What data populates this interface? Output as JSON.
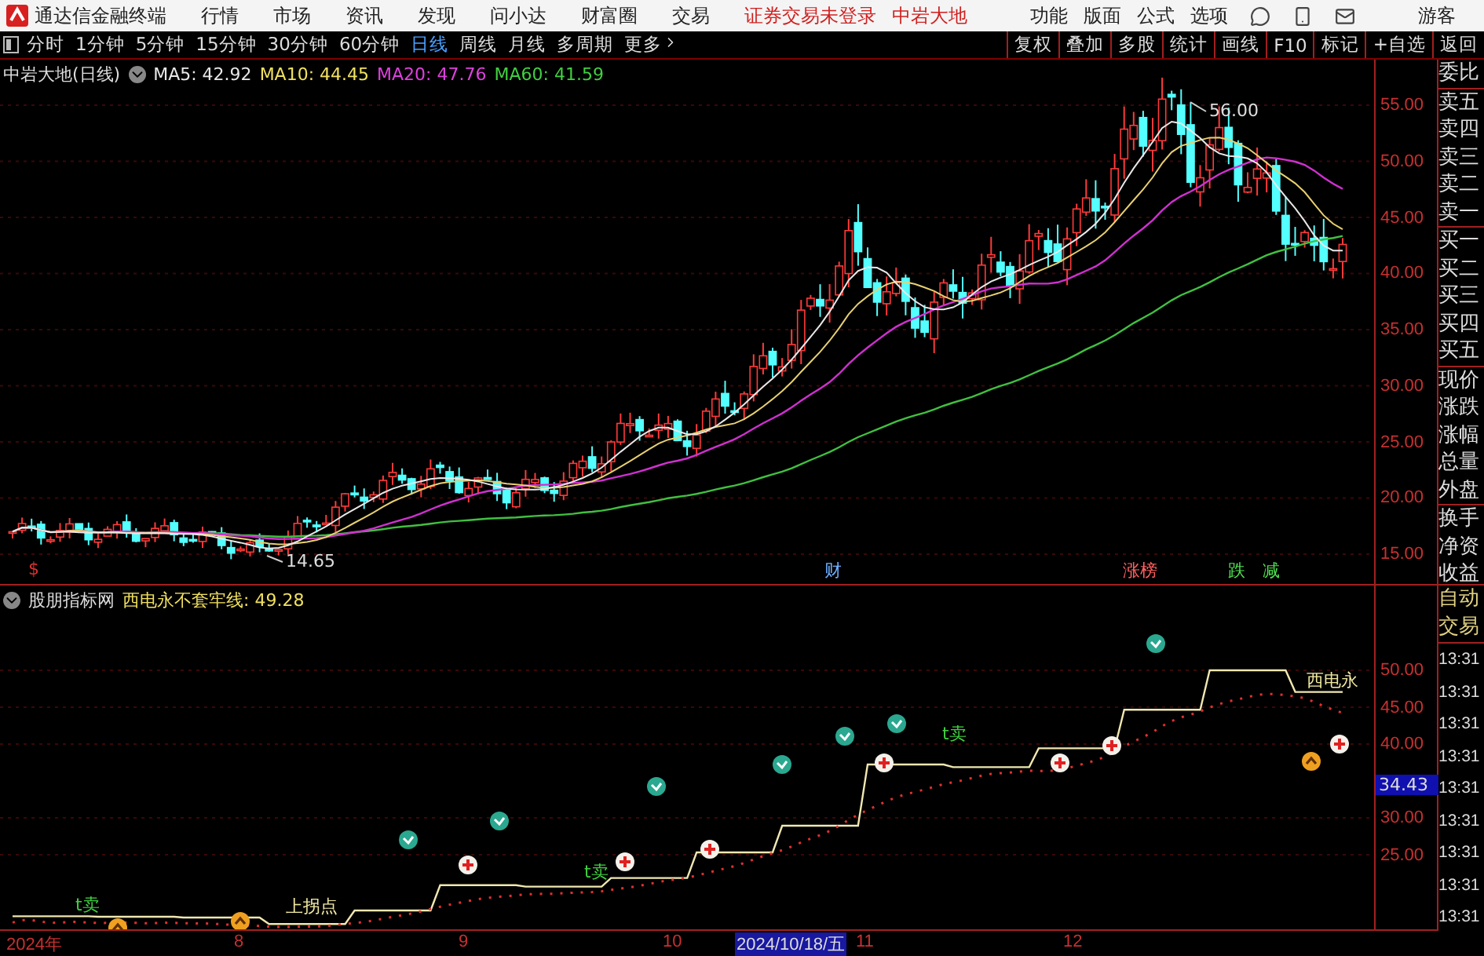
{
  "app_bar": {
    "title": "通达信金融终端",
    "menu": [
      "行情",
      "市场",
      "资讯",
      "发现",
      "问小达",
      "财富圈",
      "交易"
    ],
    "login_status": "证券交易未登录",
    "stock_name": "中岩大地",
    "right_menu": [
      "功能",
      "版面",
      "公式",
      "选项"
    ],
    "user": "游客"
  },
  "period_tabs": [
    {
      "label": "分时",
      "selected": false
    },
    {
      "label": "1分钟",
      "selected": false
    },
    {
      "label": "5分钟",
      "selected": false
    },
    {
      "label": "15分钟",
      "selected": false
    },
    {
      "label": "30分钟",
      "selected": false
    },
    {
      "label": "60分钟",
      "selected": false
    },
    {
      "label": "日线",
      "selected": true
    },
    {
      "label": "周线",
      "selected": false
    },
    {
      "label": "月线",
      "selected": false
    },
    {
      "label": "多周期",
      "selected": false
    }
  ],
  "more": "更多",
  "tool_buttons": [
    "复权",
    "叠加",
    "多股",
    "统计",
    "画线",
    "F10",
    "标记",
    "+自选",
    "返回"
  ],
  "main_chart": {
    "title": "中岩大地(日线)",
    "indicators": [
      {
        "label": "MA5: 42.92",
        "color": "#e8e8e8"
      },
      {
        "label": "MA10: 44.45",
        "color": "#f0e060"
      },
      {
        "label": "MA20: 47.76",
        "color": "#e040e0"
      },
      {
        "label": "MA60: 41.59",
        "color": "#40d040"
      }
    ],
    "high_label": "56.00",
    "low_label": "14.65",
    "y_ticks": [
      "55.00",
      "50.00",
      "45.00",
      "40.00",
      "35.00",
      "30.00",
      "25.00",
      "20.00",
      "15.00"
    ],
    "event_markers": [
      {
        "text": "$",
        "color": "#e03030"
      },
      {
        "text": "财",
        "color": "#6fb0ff"
      },
      {
        "text": "涨榜",
        "color": "#ff6060"
      },
      {
        "text": "跌",
        "color": "#50e050"
      },
      {
        "text": "减",
        "color": "#50e050"
      }
    ]
  },
  "indicator_chart": {
    "source": "股朋指标网",
    "line_name": "西电永不套牢线:",
    "value": "49.28",
    "y_ticks": [
      "50.00",
      "45.00",
      "40.00",
      "30.00",
      "25.00"
    ],
    "current_value": "34.43",
    "signal_labels": [
      {
        "text": "t卖",
        "color": "#40d040"
      },
      {
        "text": "上拐点",
        "color": "#f0e8a0"
      },
      {
        "text": "t卖",
        "color": "#40d040"
      },
      {
        "text": "t卖",
        "color": "#40d040"
      },
      {
        "text": "西电永",
        "color": "#f0e8a0"
      }
    ]
  },
  "date_axis": [
    {
      "label": "2024年",
      "selected": false
    },
    {
      "label": "8",
      "selected": false
    },
    {
      "label": "9",
      "selected": false
    },
    {
      "label": "10",
      "selected": false
    },
    {
      "label": "2024/10/18/五",
      "selected": true
    },
    {
      "label": "11",
      "selected": false
    },
    {
      "label": "12",
      "selected": false
    }
  ],
  "quote_panel": {
    "groups": [
      [
        "委比"
      ],
      [
        "卖五",
        "卖四",
        "卖三",
        "卖二",
        "卖一"
      ],
      [
        "买一",
        "买二",
        "买三",
        "买四",
        "买五"
      ],
      [
        "现价",
        "涨跌",
        "涨幅",
        "总量",
        "外盘"
      ],
      [
        "换手",
        "净资",
        "收益"
      ]
    ],
    "auto_trade": [
      "自动",
      "交易"
    ],
    "times": [
      "13:31",
      "13:31",
      "13:31",
      "13:31",
      "13:31",
      "13:31",
      "13:31",
      "13:31",
      "13:31"
    ]
  }
}
